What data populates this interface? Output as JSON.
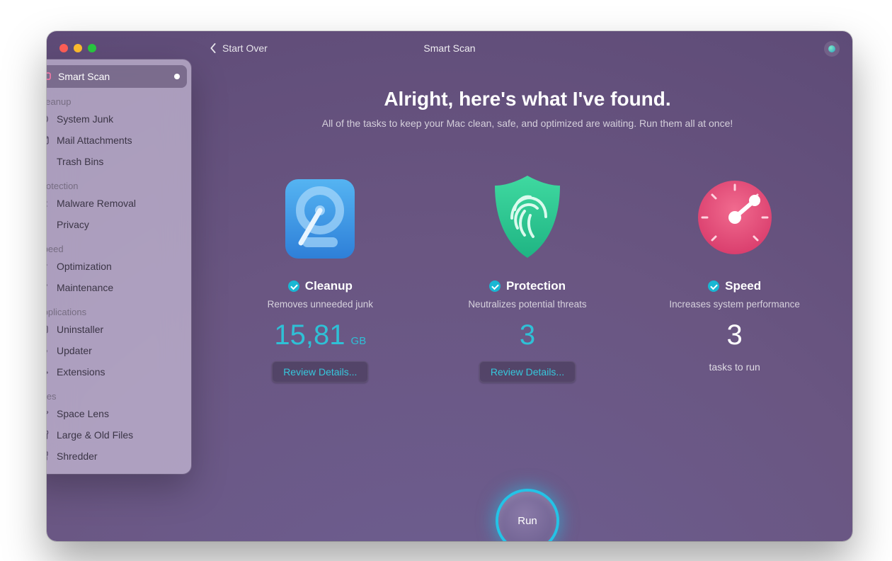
{
  "header": {
    "back_label": "Start Over",
    "title": "Smart Scan"
  },
  "sidebar": {
    "active": "Smart Scan",
    "sections": [
      {
        "header": null,
        "items": [
          {
            "label": "Smart Scan",
            "icon": "scan-icon"
          }
        ]
      },
      {
        "header": "Cleanup",
        "items": [
          {
            "label": "System Junk",
            "icon": "gauge-icon"
          },
          {
            "label": "Mail Attachments",
            "icon": "mail-icon"
          },
          {
            "label": "Trash Bins",
            "icon": "trash-icon"
          }
        ]
      },
      {
        "header": "Protection",
        "items": [
          {
            "label": "Malware Removal",
            "icon": "bug-icon"
          },
          {
            "label": "Privacy",
            "icon": "hand-icon"
          }
        ]
      },
      {
        "header": "Speed",
        "items": [
          {
            "label": "Optimization",
            "icon": "sliders-icon"
          },
          {
            "label": "Maintenance",
            "icon": "wrench-icon"
          }
        ]
      },
      {
        "header": "Applications",
        "items": [
          {
            "label": "Uninstaller",
            "icon": "uninstall-icon"
          },
          {
            "label": "Updater",
            "icon": "refresh-icon"
          },
          {
            "label": "Extensions",
            "icon": "puzzle-icon"
          }
        ]
      },
      {
        "header": "Files",
        "items": [
          {
            "label": "Space Lens",
            "icon": "planet-icon"
          },
          {
            "label": "Large & Old Files",
            "icon": "archive-icon"
          },
          {
            "label": "Shredder",
            "icon": "shredder-icon"
          }
        ]
      }
    ]
  },
  "main": {
    "headline": "Alright, here's what I've found.",
    "subline": "All of the tasks to keep your Mac clean, safe, and optimized are waiting. Run them all at once!",
    "cards": {
      "cleanup": {
        "title": "Cleanup",
        "desc": "Removes unneeded junk",
        "value": "15,81",
        "unit": "GB",
        "review": "Review Details..."
      },
      "protection": {
        "title": "Protection",
        "desc": "Neutralizes potential threats",
        "value": "3",
        "review": "Review Details..."
      },
      "speed": {
        "title": "Speed",
        "desc": "Increases system performance",
        "value": "3",
        "tasks_label": "tasks to run"
      }
    },
    "run_label": "Run"
  },
  "colors": {
    "accent_cyan": "#24c3e6",
    "cleanup_blue": "#3aa0ea",
    "protection_green": "#2ec58e",
    "speed_pink": "#e14a76"
  }
}
